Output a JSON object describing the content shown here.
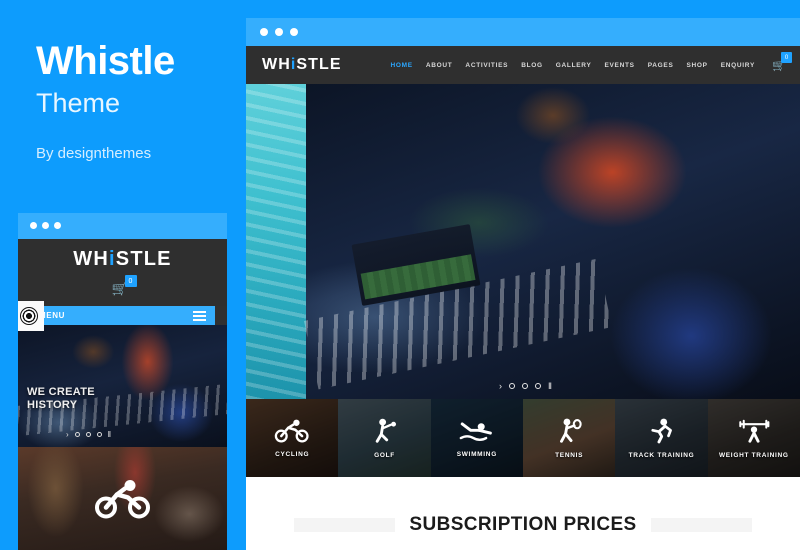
{
  "promo": {
    "title": "Whistle",
    "subtitle": "Theme",
    "byline": "By designthemes"
  },
  "colors": {
    "brand_blue": "#0d9cfd",
    "bar_blue": "#35aefd",
    "accent_link": "#2ba7ff",
    "dark_nav": "#2f2f2f"
  },
  "mobile_preview": {
    "titlebar_dots": 3,
    "logo": {
      "pre": "WH",
      "accent": "i",
      "post": "STLE"
    },
    "cart": {
      "icon": "cart-icon",
      "badge": "0"
    },
    "menu": {
      "label": "MENU",
      "icon": "hamburger-icon"
    },
    "badge_icon": "soccer-ball-icon",
    "hero": {
      "headline_line1": "WE CREATE",
      "headline_line2": "HISTORY",
      "slider": {
        "prev": "›",
        "dots": 3,
        "pause": "II"
      }
    },
    "bottom_icon": "cycling-icon"
  },
  "browser": {
    "titlebar_dots": 3,
    "logo": {
      "pre": "WH",
      "accent": "i",
      "post": "STLE"
    },
    "nav": [
      {
        "label": "HOME",
        "active": true
      },
      {
        "label": "ABOUT",
        "active": false
      },
      {
        "label": "ACTIVITIES",
        "active": false
      },
      {
        "label": "BLOG",
        "active": false
      },
      {
        "label": "GALLERY",
        "active": false
      },
      {
        "label": "EVENTS",
        "active": false
      },
      {
        "label": "PAGES",
        "active": false
      },
      {
        "label": "SHOP",
        "active": false
      },
      {
        "label": "ENQUIRY",
        "active": false
      }
    ],
    "cart": {
      "icon": "cart-icon",
      "badge": "0"
    },
    "hero": {
      "badge_icon": "soccer-ball-icon",
      "slider": {
        "prev": "›",
        "dots": 3,
        "pause": "II"
      }
    },
    "tiles": [
      {
        "label": "CYCLING",
        "icon": "cycling-icon",
        "bg": "bg-cycling"
      },
      {
        "label": "GOLF",
        "icon": "golf-icon",
        "bg": "bg-golf"
      },
      {
        "label": "SWIMMING",
        "icon": "swimming-icon",
        "bg": "bg-swim"
      },
      {
        "label": "TENNIS",
        "icon": "tennis-icon",
        "bg": "bg-tennis"
      },
      {
        "label": "TRACK TRAINING",
        "icon": "running-icon",
        "bg": "bg-track"
      },
      {
        "label": "WEIGHT TRAINING",
        "icon": "weightlifting-icon",
        "bg": "bg-weight"
      }
    ],
    "subscription": {
      "title": "SUBSCRIPTION PRICES"
    }
  }
}
